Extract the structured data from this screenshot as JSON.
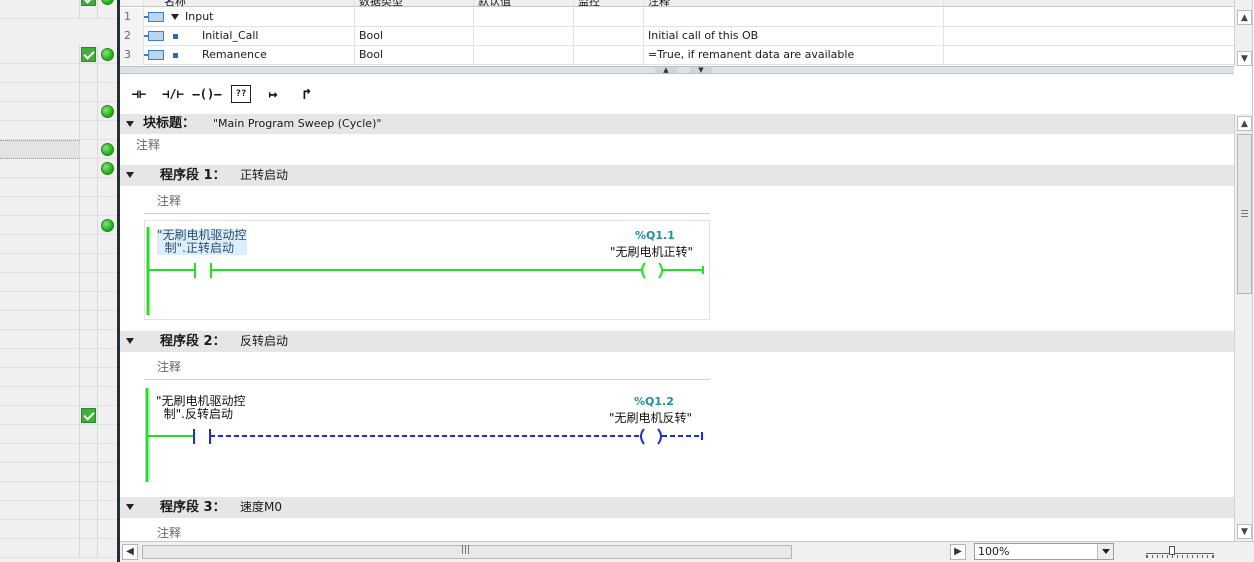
{
  "interface": {
    "headers": [
      "名称",
      "数据类型",
      "默认值",
      "监控",
      "注释"
    ],
    "rows": [
      {
        "num": "1",
        "name": "Input",
        "type": "",
        "default": "",
        "comment": ""
      },
      {
        "num": "2",
        "name": "Initial_Call",
        "type": "Bool",
        "default": "",
        "comment": "Initial call of this OB"
      },
      {
        "num": "3",
        "name": "Remanence",
        "type": "Bool",
        "default": "",
        "comment": "=True, if remanent data are available"
      }
    ]
  },
  "toolbar": {
    "no_contact": "⊣⊢",
    "nc_contact": "⊣/⊢",
    "coil": "–()–",
    "empty_box": "??",
    "open_branch": "↦",
    "close_branch": "↱"
  },
  "block": {
    "label": "块标题：",
    "title": "\"Main Program Sweep (Cycle)\"",
    "comment": "注释"
  },
  "networks": [
    {
      "label": "程序段 1：",
      "name": "正转启动",
      "comment": "注释",
      "contact_operand": "\"无刷电机驱动控\n  制\".正转启动",
      "coil_address": "%Q1.1",
      "coil_name": "\"无刷电机正转\"",
      "power_flow": true
    },
    {
      "label": "程序段 2：",
      "name": "反转启动",
      "comment": "注释",
      "contact_operand": "\"无刷电机驱动控\n  制\".反转启动",
      "coil_address": "%Q1.2",
      "coil_name": "\"无刷电机反转\"",
      "power_flow": false
    },
    {
      "label": "程序段 3：",
      "name": "速度M0",
      "comment": "注释"
    }
  ],
  "status": {
    "zoom": "100%"
  },
  "colors": {
    "energized": "#22e022",
    "not_energized": "#1c2fd6",
    "address": "#1f8fa3",
    "ok_green": "#3fae3a"
  },
  "icons": [
    "checkbox-checked-icon",
    "status-ok-icon",
    "var-input-icon",
    "collapse-icon"
  ]
}
